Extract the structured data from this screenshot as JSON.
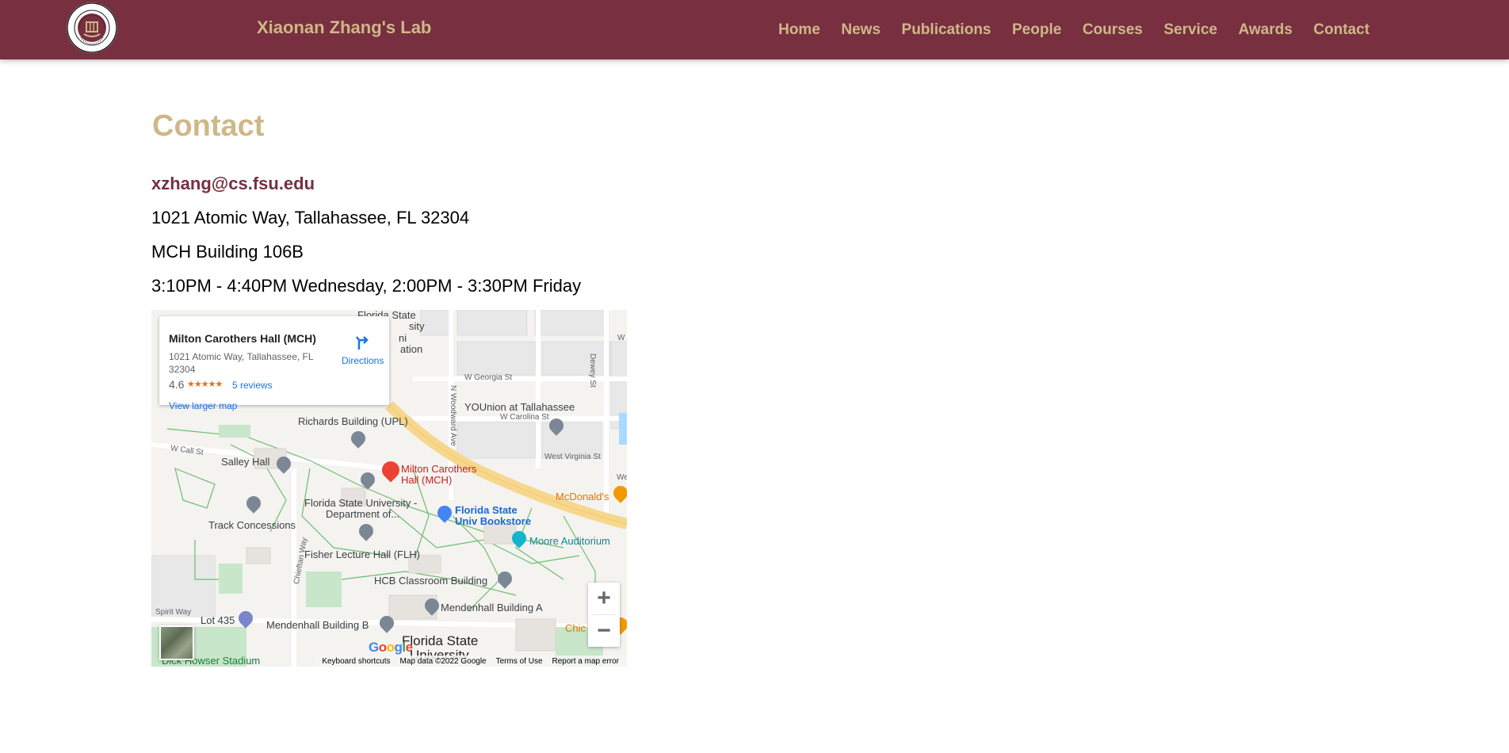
{
  "header": {
    "lab_name": "Xiaonan Zhang's Lab",
    "nav": [
      "Home",
      "News",
      "Publications",
      "People",
      "Courses",
      "Service",
      "Awards",
      "Contact"
    ],
    "logo_text": "FLORIDA STATE UNIVERSITY 1851"
  },
  "main": {
    "title": "Contact",
    "email": "xzhang@cs.fsu.edu",
    "address": "1021 Atomic Way, Tallahassee, FL 32304",
    "building": "MCH Building 106B",
    "hours": "3:10PM - 4:40PM Wednesday, 2:00PM - 3:30PM Friday"
  },
  "map": {
    "card": {
      "place_name": "Milton Carothers Hall (MCH)",
      "address": "1021 Atomic Way, Tallahassee, FL 32304",
      "rating": "4.6",
      "stars": "★★★★★",
      "reviews": "5 reviews",
      "directions": "Directions",
      "larger_map": "View larger map"
    },
    "labels": {
      "fsu_top": "Florida State",
      "fsu_top2": "sity",
      "fsu_top3": "ni",
      "fsu_top4": "ation",
      "w_georgia": "W Georgia St",
      "w_carolina": "W Carolina St",
      "younion": "YOUnion at Tallahassee",
      "west_virginia": "West Virginia St",
      "dewey": "Dewey St",
      "woodward": "N Woodward Ave",
      "richards": "Richards Building (UPL)",
      "w_call": "W Call St",
      "salley": "Salley Hall",
      "mch_pin_1": "Milton Carothers",
      "mch_pin_2": "Hall (MCH)",
      "mcdonalds": "McDonald's",
      "fsu_dept_1": "Florida State University -",
      "fsu_dept_2": "Department of...",
      "bookstore_1": "Florida State",
      "bookstore_2": "Univ Bookstore",
      "track": "Track Concessions",
      "moore": "Moore Auditorium",
      "fisher": "Fisher Lecture Hall (FLH)",
      "chieftan": "Chieftan Way",
      "hcb": "HCB Classroom Building",
      "mendenhall_a": "Mendenhall Building A",
      "spirit": "Spirit Way",
      "lot435": "Lot 435",
      "mendenhall_b": "Mendenhall Building B",
      "fsu_bottom_1": "Florida State",
      "fsu_bottom_2": "University",
      "chic": "Chic",
      "dick_howser": "Dick Howser Stadium",
      "w_edge": "W",
      "we_edge": "We"
    },
    "google_logo": "Google",
    "zoom_in": "+",
    "zoom_out": "−",
    "attribution": [
      "Keyboard shortcuts",
      "Map data ©2022 Google",
      "Terms of Use",
      "Report a map error"
    ]
  },
  "colors": {
    "garnet": "#782f40",
    "gold": "#ceb888",
    "link_blue": "#1a73e8",
    "pin_red": "#ea4335"
  }
}
